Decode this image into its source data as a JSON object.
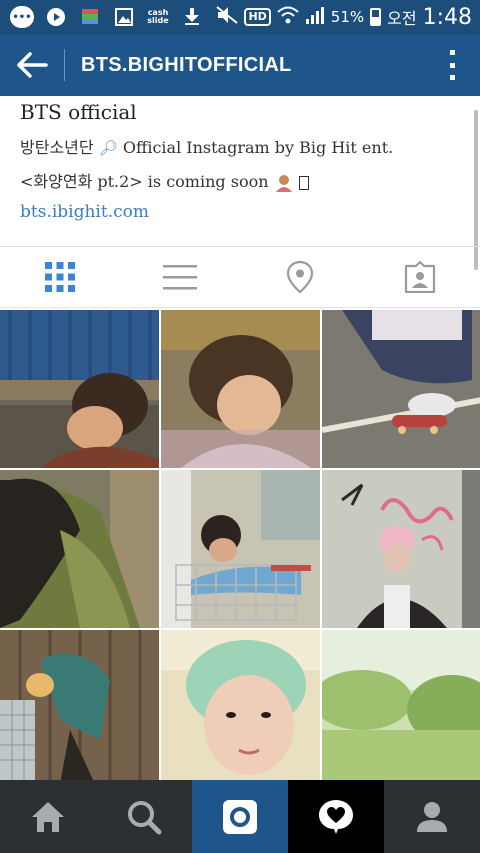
{
  "status_bar": {
    "cash_label": "cash\nslide",
    "hd_label": "HD",
    "battery": "51%",
    "ampm": "오전",
    "time": "1:48"
  },
  "app_bar": {
    "title": "BTS.BIGHITOFFICIAL"
  },
  "profile": {
    "name": "BTS official",
    "line1_prefix": "방탄소년단",
    "line1_text": "Official Instagram by Big Hit ent.",
    "line2": "<화양연화 pt.2> is coming soon",
    "link": "bts.ibighit.com"
  },
  "tabs": [
    {
      "icon": "grid-icon",
      "active": true
    },
    {
      "icon": "list-icon",
      "active": false
    },
    {
      "icon": "location-pin-icon",
      "active": false
    },
    {
      "icon": "tagged-photos-icon",
      "active": false
    }
  ],
  "photos": [
    {
      "desc": "train-tracks"
    },
    {
      "desc": "portrait-bench"
    },
    {
      "desc": "skateboard"
    },
    {
      "desc": "green-jacket"
    },
    {
      "desc": "shopping-cart"
    },
    {
      "desc": "graffiti-wall"
    },
    {
      "desc": "wooden-wall"
    },
    {
      "desc": "mint-hair"
    },
    {
      "desc": "green-field"
    }
  ],
  "bottom_nav": [
    {
      "icon": "home-icon"
    },
    {
      "icon": "search-icon"
    },
    {
      "icon": "camera-icon"
    },
    {
      "icon": "activity-heart-icon"
    },
    {
      "icon": "profile-icon"
    }
  ],
  "colors": {
    "status_bar": "#1d4d7a",
    "app_bar": "#1e568b",
    "tab_active": "#3a86d4",
    "tab_inactive": "#9a9a9a",
    "bottom_nav": "#2c2f33"
  }
}
